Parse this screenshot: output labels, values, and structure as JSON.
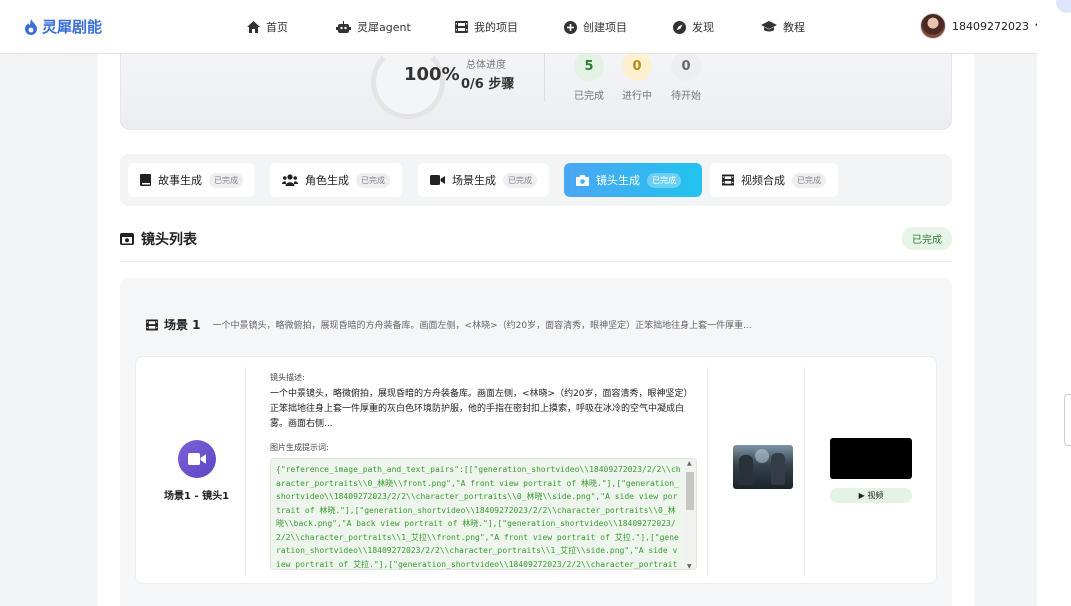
{
  "brand": {
    "name": "灵犀剧能",
    "color": "#3b6fd8"
  },
  "nav": {
    "items": [
      {
        "label": "首页",
        "icon": "home-icon"
      },
      {
        "label": "灵犀agent",
        "icon": "robot-icon"
      },
      {
        "label": "我的项目",
        "icon": "film-icon"
      },
      {
        "label": "创建项目",
        "icon": "plus-circle-icon"
      },
      {
        "label": "发现",
        "icon": "compass-icon"
      },
      {
        "label": "教程",
        "icon": "graduation-cap-icon"
      }
    ],
    "user": "18409272023"
  },
  "progress": {
    "percent": "100%",
    "percent_value": 100,
    "total_label": "总体进度",
    "steps_text": "0/6 步骤",
    "stats": [
      {
        "value": "5",
        "label": "已完成",
        "color": "#2e7d32",
        "bg": "#e3f2e5"
      },
      {
        "value": "0",
        "label": "进行中",
        "color": "#b7891a",
        "bg": "#fbf1cf"
      },
      {
        "value": "0",
        "label": "待开始",
        "color": "#666666",
        "bg": "#eceef1"
      }
    ]
  },
  "steps": [
    {
      "label": "故事生成",
      "badge": "已完成",
      "icon": "book-icon"
    },
    {
      "label": "角色生成",
      "badge": "已完成",
      "icon": "users-icon"
    },
    {
      "label": "场景生成",
      "badge": "已完成",
      "icon": "video-camera-icon"
    },
    {
      "label": "镜头生成",
      "badge": "已完成",
      "icon": "camera-icon",
      "active": true
    },
    {
      "label": "视频合成",
      "badge": "已完成",
      "icon": "film-icon"
    }
  ],
  "shot_list": {
    "title": "镜头列表",
    "status": "已完成"
  },
  "scene": {
    "name": "场景 1",
    "summary": "一个中景镜头，略微俯拍，展现昏暗的方舟装备库。画面左侧，<林晓>（约20岁，面容清秀，眼神坚定）正笨拙地往身上套一件厚重..."
  },
  "shot": {
    "label": "场景1 - 镜头1",
    "desc_title": "镜头描述:",
    "desc": "一个中景镜头，略微俯拍，展现昏暗的方舟装备库。画面左侧，<林晓>（约20岁，面容清秀，眼神坚定）正笨拙地往身上套一件厚重的灰白色环境防护服，他的手指在密封扣上摸索，呼吸在冰冷的空气中凝成白雾。画面右侧...",
    "prompt_title": "图片生成提示词:",
    "prompt": "{\"reference_image_path_and_text_pairs\":[[\"generation_shortvideo\\\\18409272023/2/2\\\\character_portraits\\\\0_林晓\\\\front.png\",\"A front view portrait of 林晓.\"],[\"generation_shortvideo\\\\18409272023/2/2\\\\character_portraits\\\\0_林晓\\\\side.png\",\"A side view portrait of 林晓.\"],[\"generation_shortvideo\\\\18409272023/2/2\\\\character_portraits\\\\0_林晓\\\\back.png\",\"A back view portrait of 林晓.\"],[\"generation_shortvideo\\\\18409272023/2/2\\\\character_portraits\\\\1_艾拉\\\\front.png\",\"A front view portrait of 艾拉.\"],[\"generation_shortvideo\\\\18409272023/2/2\\\\character_portraits\\\\1_艾拉\\\\side.png\",\"A side view portrait of 艾拉.\"],[\"generation_shortvideo\\\\18409272023/2/2\\\\character_portraits\\\\1_艾拉\\\\back.png\",\"A back view portrait of 艾拉.\"]],\"text_prompt\":\"Create an i",
    "video_button": "▶ 视频"
  }
}
